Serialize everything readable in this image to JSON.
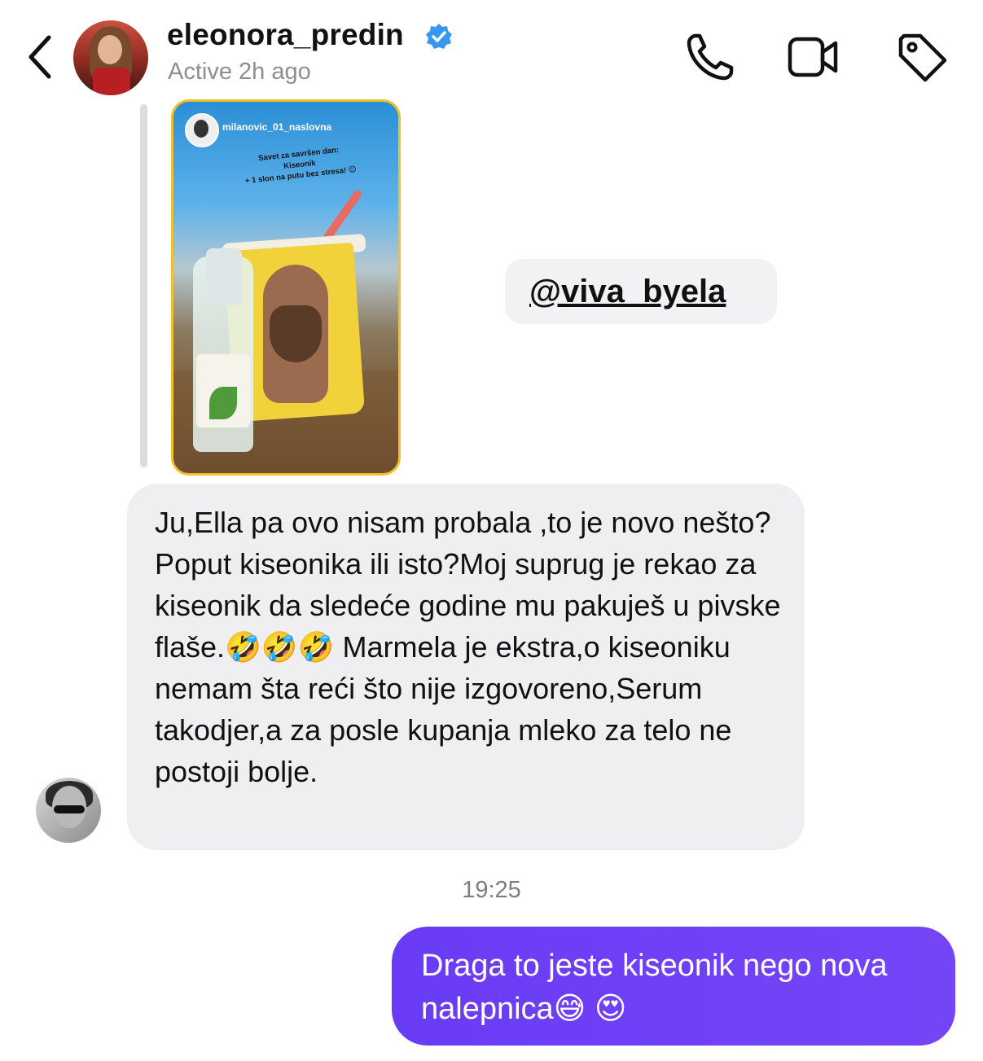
{
  "header": {
    "username": "eleonora_predin",
    "verified_icon": "verified-badge-icon",
    "status": "Active 2h ago",
    "icons": [
      "back-chevron-icon",
      "phone-icon",
      "video-camera-icon",
      "tag-icon"
    ]
  },
  "story_reply": {
    "story_user": "milanovic_01_naslovna",
    "story_text_line1": "Savet za savršen dan:",
    "story_text_line2": "Kiseonik",
    "story_text_line3": "+ 1 slon na putu bez stresa! 😊",
    "mention": "@viva_byela"
  },
  "messages": [
    {
      "direction": "incoming",
      "text": "Ju,Ella pa ovo nisam probala ,to je novo nešto?Poput kiseonika ili isto?Moj suprug je rekao za kiseonik da sledeće godine mu pakuješ u pivske flaše.🤣🤣🤣 Marmela je ekstra,o kiseoniku nemam šta reći što nije izgovoreno,Serum takodjer,a za posle kupanja mleko za telo ne postoji bolje."
    },
    {
      "direction": "outgoing",
      "text": "Draga to jeste kiseonik nego nova nalepnica😅 😍"
    }
  ],
  "timestamp": "19:25",
  "colors": {
    "outgoing_bubble": "#6a3bf5",
    "incoming_bubble": "#efeff2",
    "verified": "#3897f0",
    "muted_text": "#8e8e93"
  }
}
